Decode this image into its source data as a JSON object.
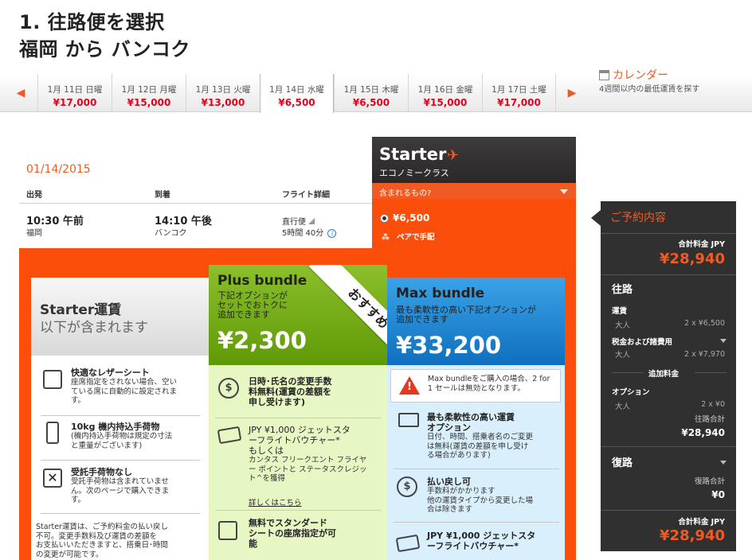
{
  "page": {
    "title_line1": "1. 往路便を選択",
    "title_line2": "福岡 から バンコク"
  },
  "date_strip": {
    "prev_arrow": "◀",
    "next_arrow": "▶",
    "dates": [
      {
        "label": "1月 11日 日曜",
        "price": "¥17,000"
      },
      {
        "label": "1月 12日 月曜",
        "price": "¥15,000"
      },
      {
        "label": "1月 13日 火曜",
        "price": "¥13,000"
      },
      {
        "label": "1月 14日 水曜",
        "price": "¥6,500",
        "selected": true
      },
      {
        "label": "1月 15日 木曜",
        "price": "¥6,500"
      },
      {
        "label": "1月 16日 金曜",
        "price": "¥15,000"
      },
      {
        "label": "1月 17日 土曜",
        "price": "¥17,000"
      }
    ],
    "calendar_label": "カレンダー",
    "calendar_sub": "4週間以内の最低運賃を探す"
  },
  "flight": {
    "date": "01/14/2015",
    "headers": {
      "depart": "出発",
      "arrive": "到着",
      "details": "フライト詳細"
    },
    "depart_time": "10:30 午前",
    "depart_city": "福岡",
    "arrive_time": "14:10 午後",
    "arrive_city": "バンコク",
    "type": "直行便",
    "duration": "5時間 40分"
  },
  "starter_fare": {
    "name": "Starter",
    "class": "エコノミークラス",
    "included_label": "含まれるもの?",
    "price": "¥6,500",
    "pair_label": "ペアで手配"
  },
  "starter_panel": {
    "title": "Starter運賃",
    "subtitle": "以下が含まれます",
    "features": [
      {
        "title": "快適なレザーシート",
        "desc": [
          "座席指定をされない場合、空い",
          "ている席に自動的に設定されま",
          "す。"
        ]
      },
      {
        "title": "10kg 機内持込手荷物",
        "desc": [
          "(機内持込手荷物は規定の寸法",
          "と重量がございます)"
        ]
      },
      {
        "title": "受託手荷物なし",
        "desc": [
          "受託手荷物は含まれていませ",
          "ん。次のページで購入できま",
          "す。"
        ]
      }
    ],
    "note": [
      "Starter運賃は、ご予約料金の払い戻し",
      "不可。変更手数料及び運賃の差額を",
      "お支払いいただきますと、搭乗日･時間",
      "の変更が可能です。"
    ]
  },
  "plus_panel": {
    "name": "Plus bundle",
    "desc": [
      "下記オプションが",
      "セットでおトクに",
      "追加できます"
    ],
    "price": "¥2,300",
    "ribbon": "おすすめ",
    "features": [
      {
        "title": [
          "日時･氏名の変更手数",
          "料無料(運賃の差額を",
          "申し受けます)"
        ]
      },
      {
        "title": [
          "JPY ¥1,000 ジェットスタ",
          "ーフライトバウチャー*",
          "もしくは"
        ],
        "desc": [
          "カンタス フリークエント フライヤ",
          "ー ポイントと ステータスクレジッ",
          "ト^を獲得"
        ],
        "link": "詳しくはこちら"
      },
      {
        "title": [
          "無料でスタンダード",
          "シートの座席指定が可",
          "能"
        ]
      }
    ]
  },
  "max_panel": {
    "name": "Max bundle",
    "desc": [
      "最も柔軟性の高い下記オプションが",
      "追加できます"
    ],
    "price": "¥33,200",
    "warning": [
      "Max bundleをご購入の場合、2 for",
      "1 セールは無効となります。"
    ],
    "features": [
      {
        "title": [
          "最も柔軟性の高い運賃",
          "オプション"
        ],
        "desc": [
          "日付、時間、搭乗者名のご変更",
          "は無料(運賃の差額を申し受け",
          "る場合があります)"
        ]
      },
      {
        "title": [
          "払い戻し可"
        ],
        "desc": [
          "手数料がかかります",
          "他の運賃タイプから変更した場",
          "合は除きます"
        ]
      },
      {
        "title": [
          "JPY ¥1,000 ジェットスタ",
          "ーフライトバウチャー*"
        ]
      }
    ]
  },
  "summary": {
    "title": "ご予約内容",
    "total_label": "合計料金 JPY",
    "total": "¥28,940",
    "outbound": "往路",
    "fare_label": "運賃",
    "adult": "大人",
    "fare_qty": "2 x ¥6,500",
    "tax_label": "税金および諸費用",
    "tax_qty": "2 x ¥7,970",
    "extras_label": "追加料金",
    "option_label": "オプション",
    "option_qty": "2 x ¥0",
    "outbound_total_label": "往路合計",
    "outbound_total": "¥28,940",
    "return": "復路",
    "return_total_label": "復路合計",
    "return_total": "¥0",
    "grand_total_label": "合計料金 JPY",
    "grand_total": "¥28,940"
  }
}
